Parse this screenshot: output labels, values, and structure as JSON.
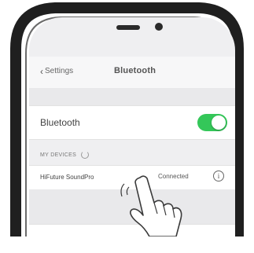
{
  "navbar": {
    "back_label": "Settings",
    "title": "Bluetooth",
    "back_icon": "chevron-left-icon"
  },
  "bluetooth_row": {
    "label": "Bluetooth",
    "toggle_on": true,
    "toggle_color": "#34c759"
  },
  "section": {
    "header": "MY DEVICES",
    "spinner_icon": "spinner-icon"
  },
  "device": {
    "name": "HiFuture SoundPro",
    "status": "Connected",
    "info_icon": "info-icon"
  },
  "colors": {
    "frame": "#1f1f1f",
    "screen_bg": "#efeff1"
  }
}
